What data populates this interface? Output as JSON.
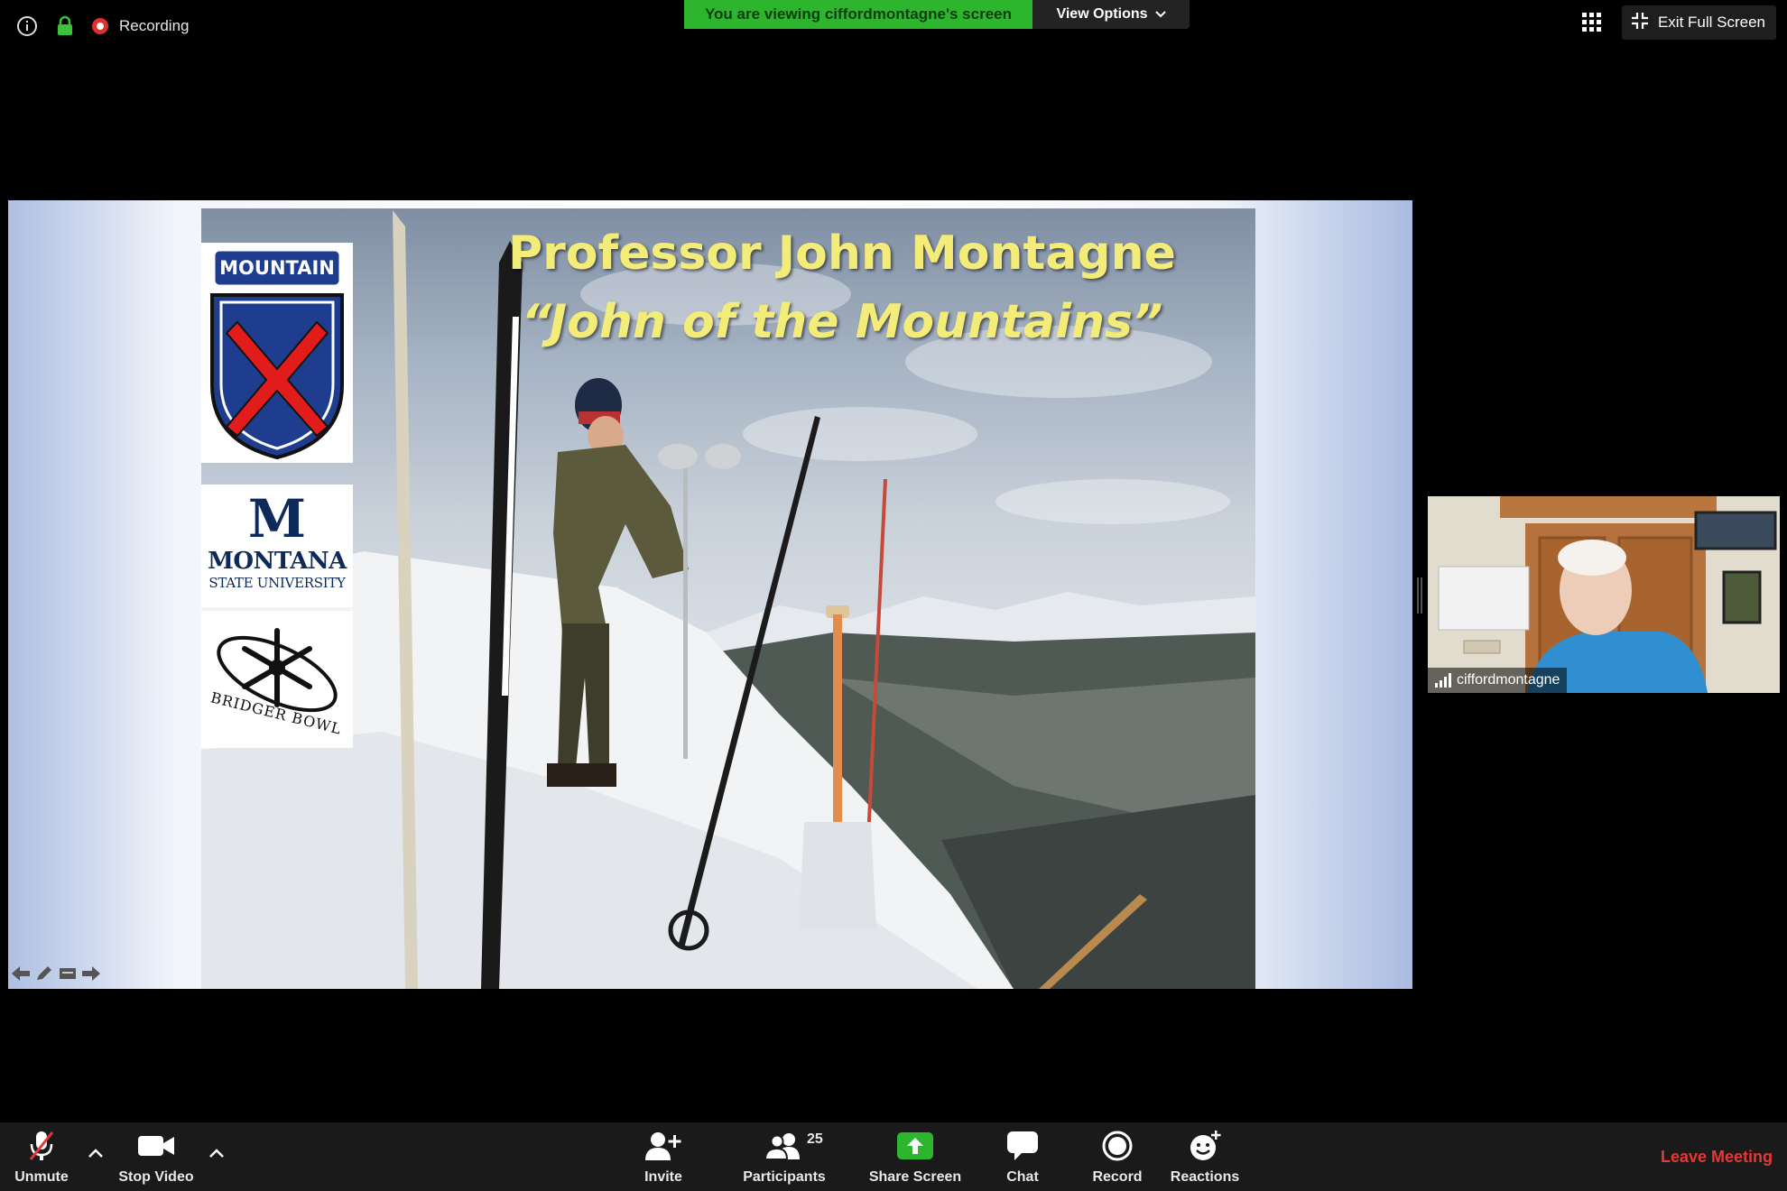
{
  "topbar": {
    "recording_label": "Recording",
    "viewing_banner": "You are viewing ciffordmontagne's screen",
    "view_options_label": "View Options",
    "exit_fullscreen_label": "Exit Full Screen"
  },
  "slide": {
    "title_line1": "Professor John Montagne",
    "title_line2": "“John of the Mountains”",
    "logos": {
      "mountain_tab": "MOUNTAIN",
      "msu_letter": "M",
      "msu_name": "MONTANA",
      "msu_sub": "STATE UNIVERSITY",
      "bridger_text": "BRIDGER BOWL"
    }
  },
  "participant": {
    "name": "ciffordmontagne"
  },
  "toolbar": {
    "unmute_label": "Unmute",
    "stop_video_label": "Stop Video",
    "invite_label": "Invite",
    "participants_label": "Participants",
    "participants_count": "25",
    "share_screen_label": "Share Screen",
    "chat_label": "Chat",
    "record_label": "Record",
    "reactions_label": "Reactions",
    "leave_label": "Leave Meeting"
  },
  "colors": {
    "share_green": "#2db52d",
    "leave_red": "#e53935",
    "recording_red": "#e02f2f",
    "lock_green": "#3cc13c",
    "title_yellow": "#f4ec78"
  },
  "icons": [
    "info-icon",
    "lock-icon",
    "recording-icon",
    "chevron-down-icon",
    "gallery-grid-icon",
    "exit-fullscreen-icon",
    "microphone-muted-icon",
    "video-camera-icon",
    "add-person-icon",
    "participants-icon",
    "share-screen-icon",
    "chat-icon",
    "record-icon",
    "reactions-icon",
    "signal-icon"
  ]
}
